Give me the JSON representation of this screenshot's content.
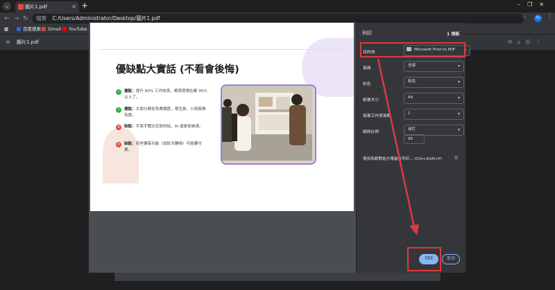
{
  "browser": {
    "tab_title": "圖片1.pdf",
    "new_tab_symbol": "+",
    "address_tag": "檔案",
    "address": "C:/Users/Administrator/Desktop/圖片1.pdf",
    "profile_initials": "Yu",
    "bookmarks": [
      {
        "label": "百度搜索",
        "color": "#3367d6"
      },
      {
        "label": "Gmail",
        "color": "#d44638"
      },
      {
        "label": "YouTube",
        "color": "#ff0000"
      }
    ]
  },
  "pdf_viewer": {
    "filename": "圖片1.pdf"
  },
  "slide": {
    "title": "優缺點大實話 (不看會後悔)",
    "bullets": [
      {
        "type": "pro",
        "symbol": "✓",
        "color": "#34a853",
        "label": "優點：",
        "text": "提升 80% 工作效率，精準度現在都 95% 以上了。"
      },
      {
        "type": "pro",
        "symbol": "✓",
        "color": "#34a853",
        "label": "優點：",
        "text": "大部分都有免費額度，學生族、小資族無負擔。"
      },
      {
        "type": "con",
        "symbol": "✕",
        "color": "#e04b43",
        "label": "缺點：",
        "text": "手寫字體太狂放的話，AI 還是會崩潰。"
      },
      {
        "type": "con",
        "symbol": "✕",
        "color": "#e04b43",
        "label": "缺點：",
        "text": "有些擴每功能（如批次轉換）可能要付費。"
      }
    ]
  },
  "print_panel": {
    "title": "列印",
    "sheet_count": "1 張紙",
    "destination_label": "目的地",
    "destination_value": "Microsoft Print to PDF",
    "pages_label": "頁面",
    "pages_value": "全部",
    "color_label": "彩色",
    "color_value": "彩色",
    "paper_label": "紙張大小",
    "paper_value": "A4",
    "pps_label": "每張工作表頁數",
    "pps_value": "1",
    "scale_label": "縮放比例",
    "scale_value": "自訂",
    "scale_input": "95",
    "system_dialog": "使用系統對話方塊進行列印... (Ctrl+Shift+P)",
    "print_button": "列印",
    "cancel_button": "取消"
  },
  "annotation_color": "#e0393e"
}
